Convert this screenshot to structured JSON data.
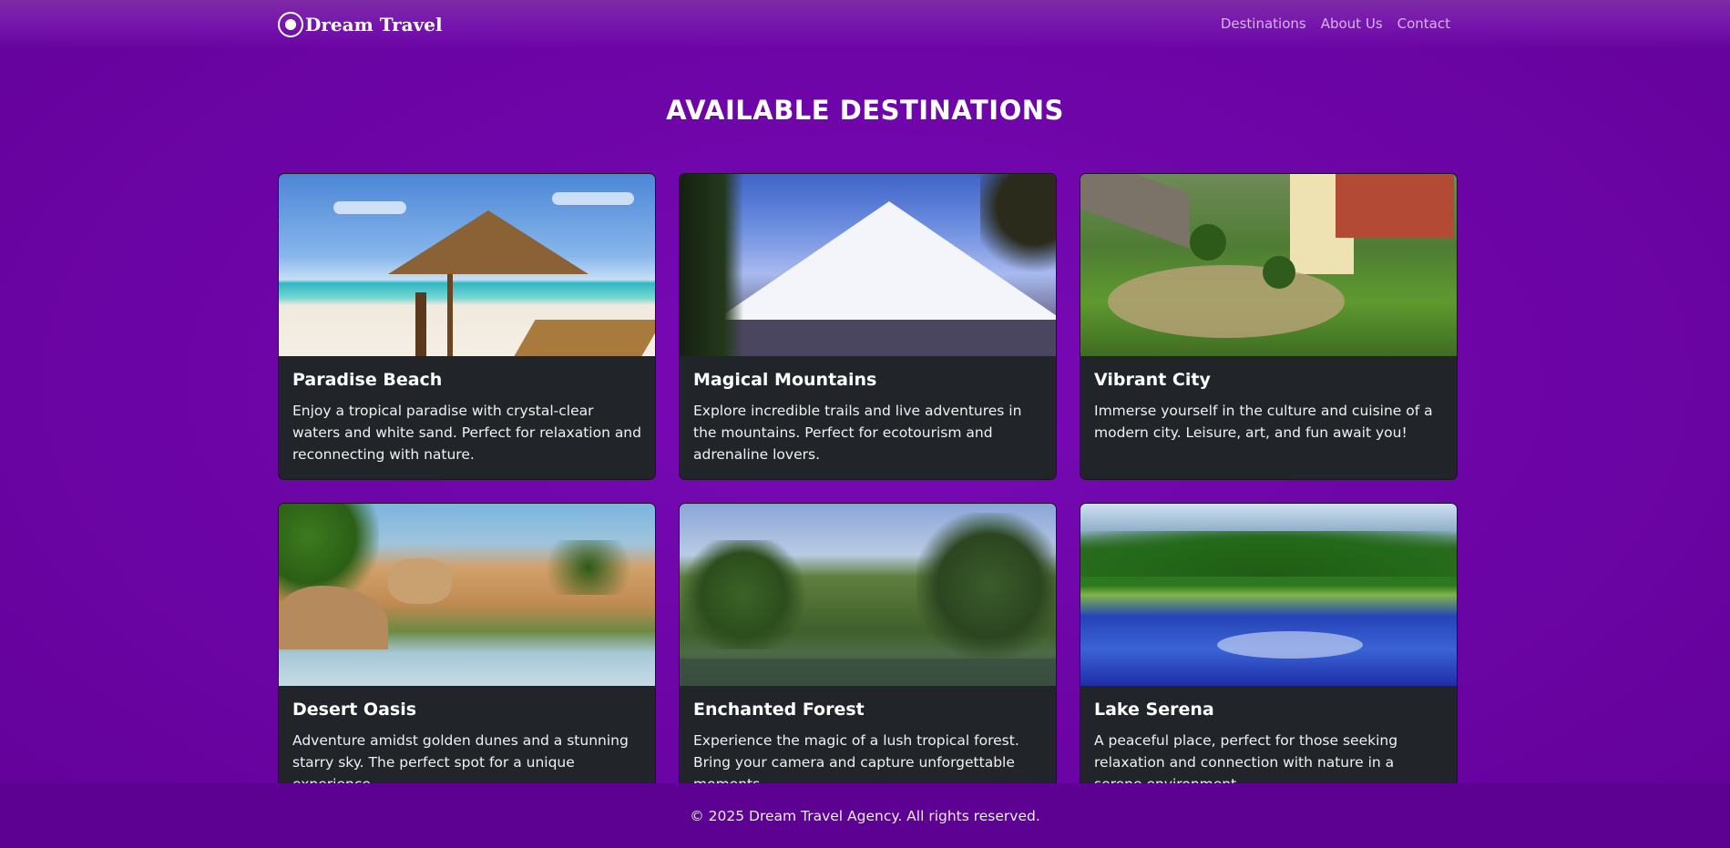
{
  "brand": {
    "name": "Dream Travel"
  },
  "nav": {
    "links": [
      {
        "label": "Destinations"
      },
      {
        "label": "About Us"
      },
      {
        "label": "Contact"
      }
    ]
  },
  "page": {
    "title": "AVAILABLE DESTINATIONS"
  },
  "destinations": [
    {
      "title": "Paradise Beach",
      "description": "Enjoy a tropical paradise with crystal-clear waters and white sand. Perfect for relaxation and reconnecting with nature.",
      "image": "beach-hut-photo"
    },
    {
      "title": "Magical Mountains",
      "description": "Explore incredible trails and live adventures in the mountains. Perfect for ecotourism and adrenaline lovers.",
      "image": "snowy-mountain-photo"
    },
    {
      "title": "Vibrant City",
      "description": "Immerse yourself in the culture and cuisine of a modern city. Leisure, art, and fun await you!",
      "image": "city-plaza-church-photo"
    },
    {
      "title": "Desert Oasis",
      "description": "Adventure amidst golden dunes and a stunning starry sky. The perfect spot for a unique experience.",
      "image": "desert-oasis-photo"
    },
    {
      "title": "Enchanted Forest",
      "description": "Experience the magic of a lush tropical forest. Bring your camera and capture unforgettable moments.",
      "image": "forest-lake-photo"
    },
    {
      "title": "Lake Serena",
      "description": "A peaceful place, perfect for those seeking relaxation and connection with nature in a serene environment.",
      "image": "blue-lake-photo"
    }
  ],
  "footer": {
    "text": "© 2025 Dream Travel Agency. All rights reserved."
  }
}
